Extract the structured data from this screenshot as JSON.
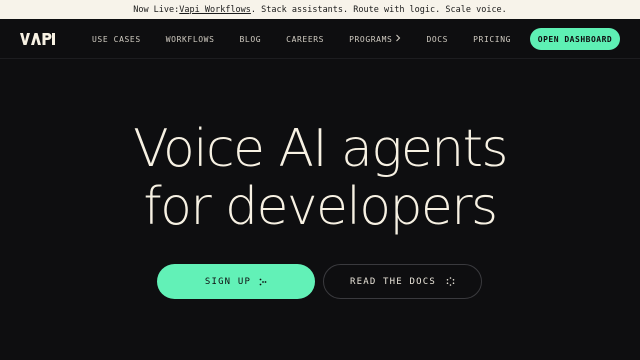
{
  "announcement": {
    "prefix": "Now Live: ",
    "link": "Vapi Workflows",
    "suffix": ". Stack assistants. Route with logic. Scale voice."
  },
  "brand": {
    "name": "VAPI"
  },
  "nav": {
    "items": [
      {
        "label": "USE CASES"
      },
      {
        "label": "WORKFLOWS"
      },
      {
        "label": "BLOG"
      },
      {
        "label": "CAREERS"
      },
      {
        "label": "PROGRAMS",
        "icon": "chevron-right-icon"
      },
      {
        "label": "DOCS"
      },
      {
        "label": "PRICING"
      }
    ],
    "cta": "OPEN DASHBOARD"
  },
  "hero": {
    "line1": "Voice AI agents",
    "line2": "for developers"
  },
  "actions": {
    "primary": "SIGN UP",
    "primary_icon": "arrow-dots-icon",
    "secondary": "READ THE DOCS",
    "secondary_icon": "spinner-dots-icon"
  },
  "colors": {
    "background": "#0e0e10",
    "accent": "#5ef0b4",
    "banner": "#f7f3ea",
    "text": "#f7f1e3"
  }
}
